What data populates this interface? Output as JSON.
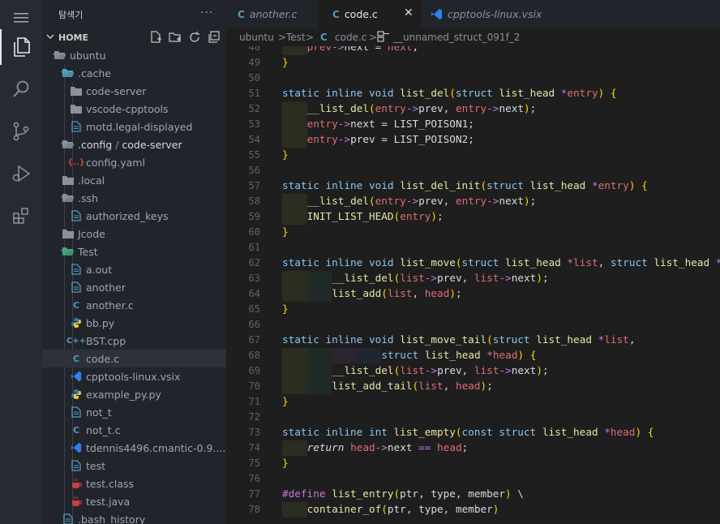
{
  "sidebar": {
    "title": "탐색기",
    "more": "···",
    "section": "HOME",
    "tree": [
      {
        "label": "ubuntu",
        "depth": 1,
        "kind": "folder-open"
      },
      {
        "label": ".cache",
        "depth": 2,
        "kind": "folder-open-special"
      },
      {
        "label": "code-server",
        "depth": 3,
        "kind": "folder"
      },
      {
        "label": "vscode-cpptools",
        "depth": 3,
        "kind": "folder"
      },
      {
        "label": "motd.legal-displayed",
        "depth": 3,
        "kind": "file"
      },
      {
        "label": ".config",
        "label2": "code-server",
        "depth": 2,
        "kind": "folder-open"
      },
      {
        "label": "config.yaml",
        "depth": 3,
        "kind": "yaml"
      },
      {
        "label": ".local",
        "depth": 2,
        "kind": "folder"
      },
      {
        "label": ".ssh",
        "depth": 2,
        "kind": "folder-open"
      },
      {
        "label": "authorized_keys",
        "depth": 3,
        "kind": "file"
      },
      {
        "label": "Jcode",
        "depth": 2,
        "kind": "folder"
      },
      {
        "label": "Test",
        "depth": 2,
        "kind": "folder-open-test"
      },
      {
        "label": "a.out",
        "depth": 3,
        "kind": "file"
      },
      {
        "label": "another",
        "depth": 3,
        "kind": "file"
      },
      {
        "label": "another.c",
        "depth": 3,
        "kind": "c"
      },
      {
        "label": "bb.py",
        "depth": 3,
        "kind": "py"
      },
      {
        "label": "BST.cpp",
        "depth": 3,
        "kind": "cpp"
      },
      {
        "label": "code.c",
        "depth": 3,
        "kind": "c",
        "selected": true
      },
      {
        "label": "cpptools-linux.vsix",
        "depth": 3,
        "kind": "vsix"
      },
      {
        "label": "example_py.py",
        "depth": 3,
        "kind": "py"
      },
      {
        "label": "not_t",
        "depth": 3,
        "kind": "file"
      },
      {
        "label": "not_t.c",
        "depth": 3,
        "kind": "c"
      },
      {
        "label": "tdennis4496.cmantic-0.9....",
        "depth": 3,
        "kind": "vsix"
      },
      {
        "label": "test",
        "depth": 3,
        "kind": "file"
      },
      {
        "label": "test.class",
        "depth": 3,
        "kind": "java"
      },
      {
        "label": "test.java",
        "depth": 3,
        "kind": "java"
      },
      {
        "label": ".bash_history",
        "depth": 2,
        "kind": "file"
      }
    ]
  },
  "tabs": [
    {
      "label": "another.c",
      "icon": "c"
    },
    {
      "label": "code.c",
      "icon": "c",
      "active": true,
      "close": "✕"
    },
    {
      "label": "cpptools-linux.vsix",
      "icon": "vsix"
    }
  ],
  "breadcrumb": {
    "p1": "ubuntu",
    "sep1": ">",
    "p2": "Test",
    "sep2": ">",
    "p3": "code.c",
    "sep3": ">",
    "p4": "__unnamed_struct_091f_2"
  },
  "editor": {
    "lines": [
      {
        "n": "48",
        "indent": 1,
        "tokens": [
          [
            "pm",
            "prev"
          ],
          [
            "op",
            "->"
          ],
          [
            "mc",
            "next "
          ],
          [
            "pu",
            "= "
          ],
          [
            "ar",
            "next"
          ],
          [
            "pu",
            ";"
          ]
        ]
      },
      {
        "n": "49",
        "indent": 0,
        "tokens": [
          [
            "br",
            "}"
          ]
        ]
      },
      {
        "n": "50",
        "indent": 0,
        "tokens": []
      },
      {
        "n": "51",
        "indent": 0,
        "tokens": [
          [
            "kw",
            "static inline void "
          ],
          [
            "fn",
            "list_del"
          ],
          [
            "br",
            "("
          ],
          [
            "kw",
            "struct "
          ],
          [
            "fn",
            "list_head "
          ],
          [
            "op",
            "*"
          ],
          [
            "ar",
            "entry"
          ],
          [
            "br",
            ") {"
          ]
        ]
      },
      {
        "n": "52",
        "indent": 1,
        "tokens": [
          [
            "fn",
            "__list_del"
          ],
          [
            "br",
            "("
          ],
          [
            "ar",
            "entry"
          ],
          [
            "op",
            "->"
          ],
          [
            "mc",
            "prev"
          ],
          [
            "pu",
            ", "
          ],
          [
            "ar",
            "entry"
          ],
          [
            "op",
            "->"
          ],
          [
            "mc",
            "next"
          ],
          [
            "br",
            ")"
          ],
          [
            "pu",
            ";"
          ]
        ]
      },
      {
        "n": "53",
        "indent": 1,
        "tokens": [
          [
            "ar",
            "entry"
          ],
          [
            "op",
            "->"
          ],
          [
            "mc",
            "next "
          ],
          [
            "pu",
            "= "
          ],
          [
            "mc",
            "LIST_POISON1"
          ],
          [
            "pu",
            ";"
          ]
        ]
      },
      {
        "n": "54",
        "indent": 1,
        "tokens": [
          [
            "ar",
            "entry"
          ],
          [
            "op",
            "->"
          ],
          [
            "mc",
            "prev "
          ],
          [
            "pu",
            "= "
          ],
          [
            "mc",
            "LIST_POISON2"
          ],
          [
            "pu",
            ";"
          ]
        ]
      },
      {
        "n": "55",
        "indent": 0,
        "tokens": [
          [
            "br",
            "}"
          ]
        ]
      },
      {
        "n": "56",
        "indent": 0,
        "tokens": []
      },
      {
        "n": "57",
        "indent": 0,
        "tokens": [
          [
            "kw",
            "static inline void "
          ],
          [
            "fn",
            "list_del_init"
          ],
          [
            "br",
            "("
          ],
          [
            "kw",
            "struct "
          ],
          [
            "fn",
            "list_head "
          ],
          [
            "op",
            "*"
          ],
          [
            "ar",
            "entry"
          ],
          [
            "br",
            ") {"
          ]
        ]
      },
      {
        "n": "58",
        "indent": 1,
        "tokens": [
          [
            "fn",
            "__list_del"
          ],
          [
            "br",
            "("
          ],
          [
            "ar",
            "entry"
          ],
          [
            "op",
            "->"
          ],
          [
            "mc",
            "prev"
          ],
          [
            "pu",
            ", "
          ],
          [
            "ar",
            "entry"
          ],
          [
            "op",
            "->"
          ],
          [
            "mc",
            "next"
          ],
          [
            "br",
            ")"
          ],
          [
            "pu",
            ";"
          ]
        ]
      },
      {
        "n": "59",
        "indent": 1,
        "tokens": [
          [
            "fn",
            "INIT_LIST_HEAD"
          ],
          [
            "br",
            "("
          ],
          [
            "ar",
            "entry"
          ],
          [
            "br",
            ")"
          ],
          [
            "pu",
            ";"
          ]
        ]
      },
      {
        "n": "60",
        "indent": 0,
        "tokens": [
          [
            "br",
            "}"
          ]
        ]
      },
      {
        "n": "61",
        "indent": 0,
        "tokens": []
      },
      {
        "n": "62",
        "indent": 0,
        "tokens": [
          [
            "kw",
            "static inline void "
          ],
          [
            "fn",
            "list_move"
          ],
          [
            "br",
            "("
          ],
          [
            "kw",
            "struct "
          ],
          [
            "fn",
            "list_head "
          ],
          [
            "op",
            "*"
          ],
          [
            "ar",
            "list"
          ],
          [
            "pu",
            ", "
          ],
          [
            "kw",
            "struct "
          ],
          [
            "fn",
            "list_head "
          ],
          [
            "op",
            "*"
          ]
        ]
      },
      {
        "n": "63",
        "indent": 2,
        "tokens": [
          [
            "fn",
            "__list_del"
          ],
          [
            "br",
            "("
          ],
          [
            "ar",
            "list"
          ],
          [
            "op",
            "->"
          ],
          [
            "mc",
            "prev"
          ],
          [
            "pu",
            ", "
          ],
          [
            "ar",
            "list"
          ],
          [
            "op",
            "->"
          ],
          [
            "mc",
            "next"
          ],
          [
            "br",
            ")"
          ],
          [
            "pu",
            ";"
          ]
        ]
      },
      {
        "n": "64",
        "indent": 2,
        "tokens": [
          [
            "fn",
            "list_add"
          ],
          [
            "br",
            "("
          ],
          [
            "ar",
            "list"
          ],
          [
            "pu",
            ", "
          ],
          [
            "ar",
            "head"
          ],
          [
            "br",
            ")"
          ],
          [
            "pu",
            ";"
          ]
        ]
      },
      {
        "n": "65",
        "indent": 0,
        "tokens": [
          [
            "br",
            "}"
          ]
        ]
      },
      {
        "n": "66",
        "indent": 0,
        "tokens": []
      },
      {
        "n": "67",
        "indent": 0,
        "tokens": [
          [
            "kw",
            "static inline void "
          ],
          [
            "fn",
            "list_move_tail"
          ],
          [
            "br",
            "("
          ],
          [
            "kw",
            "struct "
          ],
          [
            "fn",
            "list_head "
          ],
          [
            "op",
            "*"
          ],
          [
            "ar",
            "list"
          ],
          [
            "pu",
            ","
          ]
        ]
      },
      {
        "n": "68",
        "indent": 4,
        "tokens": [
          [
            "kw",
            "struct "
          ],
          [
            "fn",
            "list_head "
          ],
          [
            "op",
            "*"
          ],
          [
            "ar",
            "head"
          ],
          [
            "br",
            ") {"
          ]
        ]
      },
      {
        "n": "69",
        "indent": 2,
        "tokens": [
          [
            "fn",
            "__list_del"
          ],
          [
            "br",
            "("
          ],
          [
            "ar",
            "list"
          ],
          [
            "op",
            "->"
          ],
          [
            "mc",
            "prev"
          ],
          [
            "pu",
            ", "
          ],
          [
            "ar",
            "list"
          ],
          [
            "op",
            "->"
          ],
          [
            "mc",
            "next"
          ],
          [
            "br",
            ")"
          ],
          [
            "pu",
            ";"
          ]
        ]
      },
      {
        "n": "70",
        "indent": 2,
        "tokens": [
          [
            "fn",
            "list_add_tail"
          ],
          [
            "br",
            "("
          ],
          [
            "ar",
            "list"
          ],
          [
            "pu",
            ", "
          ],
          [
            "ar",
            "head"
          ],
          [
            "br",
            ")"
          ],
          [
            "pu",
            ";"
          ]
        ]
      },
      {
        "n": "71",
        "indent": 0,
        "tokens": [
          [
            "br",
            "}"
          ]
        ]
      },
      {
        "n": "72",
        "indent": 0,
        "tokens": []
      },
      {
        "n": "73",
        "indent": 0,
        "tokens": [
          [
            "kw",
            "static inline int "
          ],
          [
            "fn",
            "list_empty"
          ],
          [
            "br",
            "("
          ],
          [
            "kw",
            "const struct "
          ],
          [
            "fn",
            "list_head "
          ],
          [
            "op",
            "*"
          ],
          [
            "ar",
            "head"
          ],
          [
            "br",
            ") {"
          ]
        ]
      },
      {
        "n": "74",
        "indent": 1,
        "tokens": [
          [
            "it",
            "return "
          ],
          [
            "ar",
            "head"
          ],
          [
            "op",
            "->"
          ],
          [
            "mc",
            "next "
          ],
          [
            "op",
            "== "
          ],
          [
            "ar",
            "head"
          ],
          [
            "pu",
            ";"
          ]
        ]
      },
      {
        "n": "75",
        "indent": 0,
        "tokens": [
          [
            "br",
            "}"
          ]
        ]
      },
      {
        "n": "76",
        "indent": 0,
        "tokens": []
      },
      {
        "n": "77",
        "indent": 0,
        "tokens": [
          [
            "pr",
            "#define "
          ],
          [
            "fn",
            "list_entry"
          ],
          [
            "br",
            "("
          ],
          [
            "mc",
            "ptr"
          ],
          [
            "pu",
            ", "
          ],
          [
            "mc",
            "type"
          ],
          [
            "pu",
            ", "
          ],
          [
            "mc",
            "member"
          ],
          [
            "br",
            ")"
          ],
          [
            "pu",
            " \\"
          ]
        ]
      },
      {
        "n": "78",
        "indent": 1,
        "tokens": [
          [
            "fn",
            "container_of"
          ],
          [
            "br",
            "("
          ],
          [
            "mc",
            "ptr"
          ],
          [
            "pu",
            ", "
          ],
          [
            "mc",
            "type"
          ],
          [
            "pu",
            ", "
          ],
          [
            "mc",
            "member"
          ],
          [
            "br",
            ")"
          ]
        ]
      }
    ]
  },
  "colors": {
    "folder": "#8a919c",
    "file": "#519aba",
    "c": "#519aba",
    "py": "#e8c33b",
    "java": "#cc3e44",
    "yaml": "#a074c4",
    "vsix": "#2f80ed"
  }
}
